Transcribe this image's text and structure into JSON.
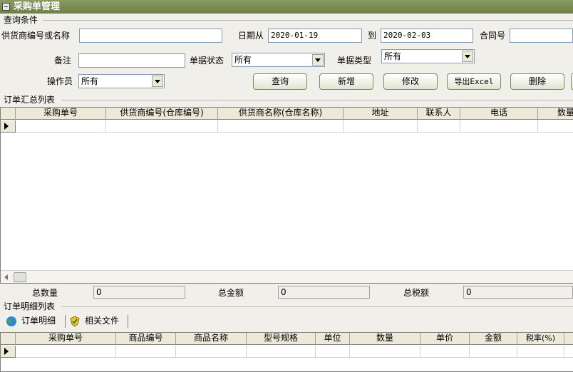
{
  "window": {
    "title": "采购单管理"
  },
  "query": {
    "section_label": "查询条件",
    "supplier_label": "供货商编号或名称",
    "supplier_value": "",
    "date_from_label": "日期从",
    "date_from_value": "2020-01-19",
    "date_to_label": "到",
    "date_to_value": "2020-02-03",
    "contract_label": "合同号",
    "contract_value": "",
    "remark_label": "备注",
    "remark_value": "",
    "status_label": "单据状态",
    "status_value": "所有",
    "type_label": "单据类型",
    "type_value": "所有",
    "operator_label": "操作员",
    "operator_value": "所有"
  },
  "buttons": {
    "query": "查询",
    "add": "新增",
    "edit": "修改",
    "export": "导出Excel",
    "delete": "删除"
  },
  "summary_list": {
    "section_label": "订单汇总列表",
    "columns": [
      "采购单号",
      "供货商编号(仓库编号)",
      "供货商名称(仓库名称)",
      "地址",
      "联系人",
      "电话",
      "数量"
    ]
  },
  "totals": {
    "qty_label": "总数量",
    "qty_value": "0",
    "amount_label": "总金额",
    "amount_value": "0",
    "tax_label": "总税额",
    "tax_value": "0"
  },
  "detail_list": {
    "section_label": "订单明细列表",
    "tabs": [
      {
        "label": "订单明细",
        "icon": "globe-icon"
      },
      {
        "label": "相关文件",
        "icon": "shield-icon"
      }
    ],
    "columns": [
      "采购单号",
      "商品编号",
      "商品名称",
      "型号规格",
      "单位",
      "数量",
      "单价",
      "金额",
      "税率(%)"
    ]
  }
}
